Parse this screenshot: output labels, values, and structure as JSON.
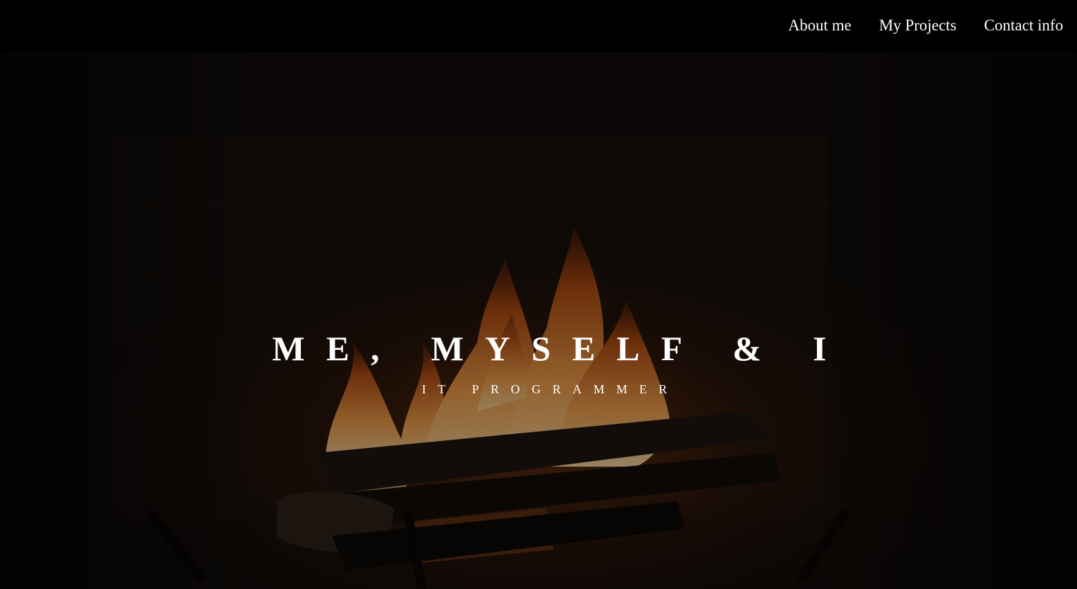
{
  "nav": {
    "items": [
      {
        "label": "About me"
      },
      {
        "label": "My Projects"
      },
      {
        "label": "Contact info"
      }
    ]
  },
  "hero": {
    "title": "ME, MYSELF & I",
    "subtitle": "IT PROGRAMMER",
    "background": "fireplace-image"
  },
  "colors": {
    "navbar_bg": "#000000",
    "text": "#ffffff",
    "flame": "#e8953a",
    "overlay": "#0d0a08"
  }
}
